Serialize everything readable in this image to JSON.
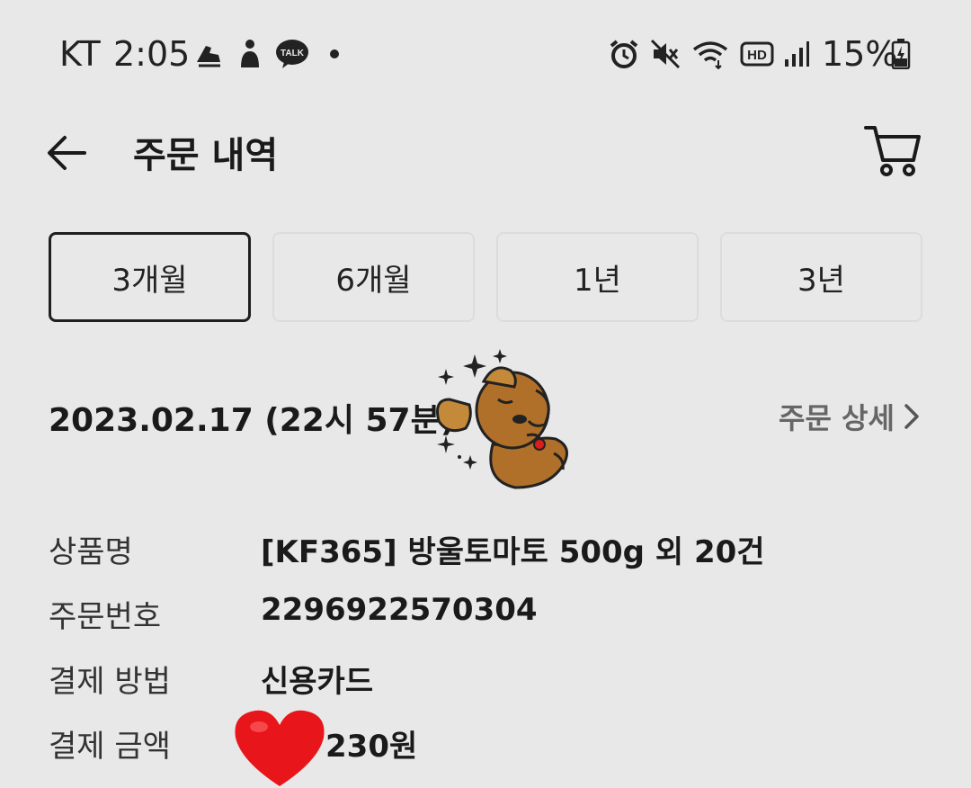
{
  "status_bar": {
    "carrier": "KT",
    "time": "2:05",
    "battery": "15%",
    "icons": [
      "running-shoe-icon",
      "person-icon",
      "kakaotalk-icon",
      "notification-dot-icon",
      "alarm-icon",
      "mute-icon",
      "wifi-icon",
      "hd-icon",
      "signal-icon",
      "battery-charging-icon"
    ],
    "talk_badge": "TALK",
    "hd_badge": "HD"
  },
  "header": {
    "title": "주문 내역"
  },
  "filters": [
    {
      "label": "3개월",
      "active": true
    },
    {
      "label": "6개월",
      "active": false
    },
    {
      "label": "1년",
      "active": false
    },
    {
      "label": "3년",
      "active": false
    }
  ],
  "order": {
    "date": "2023.02.17 (22시 57분)",
    "detail_link": "주문 상세",
    "fields": [
      {
        "label": "상품명",
        "value": "[KF365] 방울토마토 500g 외 20건"
      },
      {
        "label": "주문번호",
        "value": "2296922570304"
      },
      {
        "label": "결제 방법",
        "value": "신용카드"
      },
      {
        "label": "결제 금액",
        "value": "230원"
      }
    ]
  },
  "colors": {
    "background": "#e8e8e8",
    "active_border": "#1f1f1f",
    "heart": "#e8151b"
  }
}
